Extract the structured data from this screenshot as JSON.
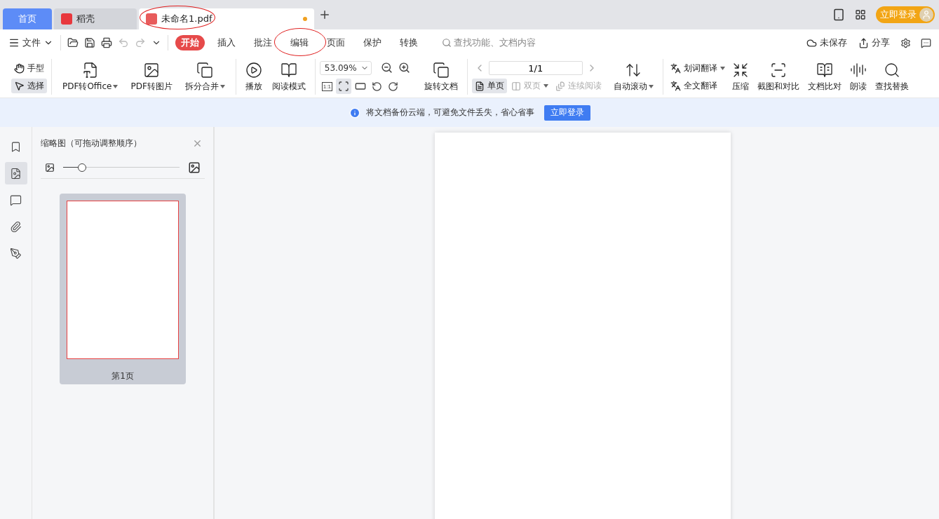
{
  "tabs": [
    {
      "label": "首页",
      "kind": "home",
      "selected": false,
      "unsaved": false,
      "annotated": false
    },
    {
      "label": "稻壳",
      "kind": "docer",
      "selected": false,
      "unsaved": false,
      "annotated": false
    },
    {
      "label": "未命名1.pdf",
      "kind": "document",
      "selected": true,
      "unsaved": true,
      "annotated": true
    }
  ],
  "account": {
    "login": "立即登录"
  },
  "menu": {
    "file": "文件",
    "ribbon_tabs": [
      {
        "label": "开始",
        "selected": true,
        "annotated": false
      },
      {
        "label": "插入",
        "selected": false,
        "annotated": false
      },
      {
        "label": "批注",
        "selected": false,
        "annotated": false
      },
      {
        "label": "编辑",
        "selected": false,
        "annotated": true
      },
      {
        "label": "页面",
        "selected": false,
        "annotated": false
      },
      {
        "label": "保护",
        "selected": false,
        "annotated": false
      },
      {
        "label": "转换",
        "selected": false,
        "annotated": false
      }
    ],
    "search": {
      "placeholder": "查找功能、文档内容"
    },
    "save_status": "未保存",
    "share": "分享"
  },
  "toolbar": {
    "cursor_tools": [
      {
        "label": "手型",
        "selected": false
      },
      {
        "label": "选择",
        "selected": true
      }
    ],
    "convert": [
      {
        "label": "PDF转Office",
        "dropdown": true
      },
      {
        "label": "PDF转图片",
        "dropdown": false
      },
      {
        "label": "拆分合并",
        "dropdown": true
      }
    ],
    "view": [
      {
        "label": "播放"
      },
      {
        "label": "阅读模式"
      }
    ],
    "zoom": {
      "value": "53.09%",
      "fit_modes": [
        {
          "label": "1:1",
          "selected": false
        },
        {
          "selected": true
        },
        {
          "selected": false
        }
      ],
      "rotate": "旋转文档"
    },
    "pager": {
      "value": "1/1",
      "layouts": [
        {
          "label": "单页",
          "selected": true,
          "disabled": false,
          "dropdown": false
        },
        {
          "label": "双页",
          "selected": false,
          "disabled": true,
          "dropdown": true
        },
        {
          "label": "连续阅读",
          "selected": false,
          "disabled": true,
          "dropdown": false
        }
      ],
      "auto_scroll": {
        "label": "自动滚动",
        "dropdown": true
      }
    },
    "translate": [
      {
        "label": "划词翻译",
        "dropdown": true
      },
      {
        "label": "全文翻译",
        "dropdown": false
      }
    ],
    "tools": [
      {
        "label": "压缩"
      },
      {
        "label": "截图和对比"
      },
      {
        "label": "文档比对"
      },
      {
        "label": "朗读"
      },
      {
        "label": "查找替换"
      }
    ]
  },
  "banner": {
    "message": "将文档备份云端，可避免文件丢失，省心省事",
    "button": "立即登录"
  },
  "sidebar": {
    "items": [
      {
        "selected": false
      },
      {
        "selected": true
      },
      {
        "selected": false
      },
      {
        "selected": false
      },
      {
        "selected": false
      }
    ]
  },
  "thumbnails": {
    "title": "缩略图（可拖动调整顺序）",
    "size": {
      "level": 0.16
    },
    "pages": [
      {
        "label": "第1页",
        "selected": true
      }
    ]
  }
}
